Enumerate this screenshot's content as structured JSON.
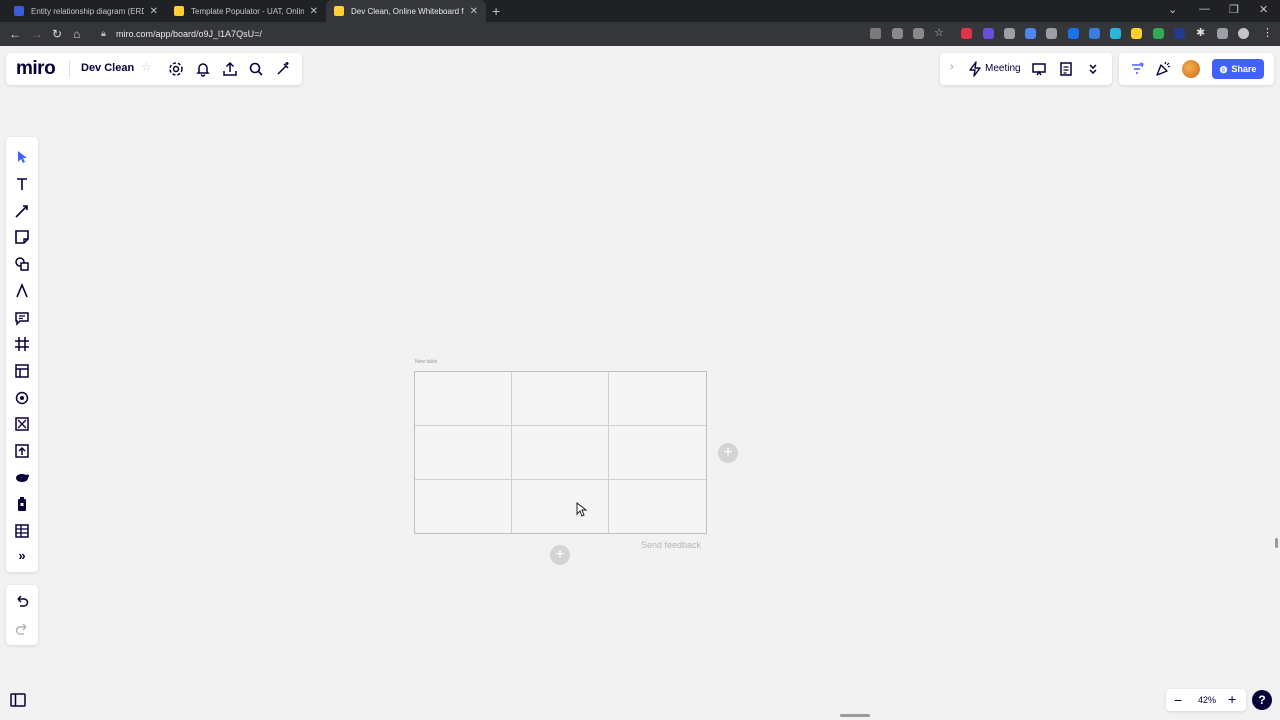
{
  "browser": {
    "tabs": [
      {
        "title": "Entity relationship diagram (ERD",
        "icon": "word-icon",
        "active": false
      },
      {
        "title": "Template Populator - UAT, Online",
        "icon": "miro-favicon-icon",
        "active": false
      },
      {
        "title": "Dev Clean, Online Whiteboard fo",
        "icon": "miro-favicon-icon",
        "active": true
      }
    ],
    "url": "miro.com/app/board/o9J_l1A7QsU=/"
  },
  "header": {
    "logo": "miro",
    "board_name": "Dev Clean",
    "meeting_label": "Meeting",
    "share_label": "Share"
  },
  "canvas": {
    "table_caption": "New table",
    "table_rows": 3,
    "table_cols": 3,
    "feedback_label": "Send feedback"
  },
  "zoom": {
    "level": "42%"
  },
  "help_label": "?",
  "colors": {
    "accent": "#4262ff",
    "ink": "#050038",
    "canvas": "#f2f2f2"
  }
}
